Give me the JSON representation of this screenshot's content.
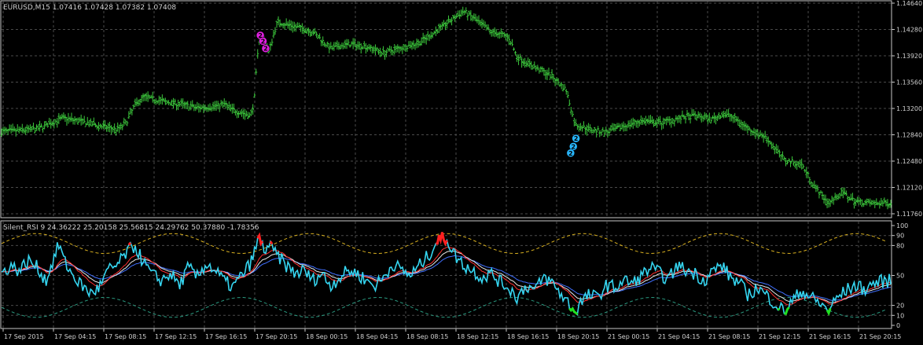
{
  "chart_data": [
    {
      "type": "candlestick",
      "title": "EURUSD,M15  1.07416 1.07428 1.07382 1.07408",
      "symbol": "EURUSD",
      "timeframe": "M15",
      "quote": {
        "open": "1.07416",
        "high": "1.07428",
        "low": "1.07382",
        "close": "1.07408"
      },
      "yticks": [
        "1.14640",
        "1.14280",
        "1.13920",
        "1.13560",
        "1.13200",
        "1.12840",
        "1.12480",
        "1.12120",
        "1.11760"
      ],
      "ylim": [
        1.1176,
        1.1464
      ],
      "grid": true,
      "price_path": [
        [
          0.0,
          1.1288
        ],
        [
          0.02,
          1.129
        ],
        [
          0.04,
          1.1292
        ],
        [
          0.06,
          1.1302
        ],
        [
          0.07,
          1.1307
        ],
        [
          0.09,
          1.1302
        ],
        [
          0.11,
          1.1296
        ],
        [
          0.13,
          1.1291
        ],
        [
          0.14,
          1.13
        ],
        [
          0.15,
          1.1325
        ],
        [
          0.16,
          1.1336
        ],
        [
          0.18,
          1.133
        ],
        [
          0.2,
          1.1326
        ],
        [
          0.22,
          1.1321
        ],
        [
          0.24,
          1.1323
        ],
        [
          0.25,
          1.1326
        ],
        [
          0.26,
          1.1318
        ],
        [
          0.28,
          1.131
        ],
        [
          0.284,
          1.1328
        ],
        [
          0.287,
          1.138
        ],
        [
          0.29,
          1.1418
        ],
        [
          0.297,
          1.141
        ],
        [
          0.3,
          1.1395
        ],
        [
          0.31,
          1.1438
        ],
        [
          0.33,
          1.1432
        ],
        [
          0.35,
          1.1425
        ],
        [
          0.37,
          1.1402
        ],
        [
          0.39,
          1.1408
        ],
        [
          0.41,
          1.1405
        ],
        [
          0.43,
          1.1396
        ],
        [
          0.45,
          1.1403
        ],
        [
          0.47,
          1.141
        ],
        [
          0.48,
          1.1418
        ],
        [
          0.5,
          1.1436
        ],
        [
          0.52,
          1.1453
        ],
        [
          0.53,
          1.1444
        ],
        [
          0.55,
          1.1425
        ],
        [
          0.57,
          1.1418
        ],
        [
          0.58,
          1.139
        ],
        [
          0.6,
          1.1376
        ],
        [
          0.61,
          1.137
        ],
        [
          0.62,
          1.1363
        ],
        [
          0.635,
          1.1345
        ],
        [
          0.645,
          1.1298
        ],
        [
          0.66,
          1.1292
        ],
        [
          0.68,
          1.1287
        ],
        [
          0.7,
          1.1296
        ],
        [
          0.72,
          1.1303
        ],
        [
          0.74,
          1.13
        ],
        [
          0.76,
          1.1306
        ],
        [
          0.78,
          1.131
        ],
        [
          0.8,
          1.1305
        ],
        [
          0.81,
          1.1312
        ],
        [
          0.82,
          1.131
        ],
        [
          0.84,
          1.1292
        ],
        [
          0.86,
          1.128
        ],
        [
          0.87,
          1.1265
        ],
        [
          0.88,
          1.125
        ],
        [
          0.9,
          1.1243
        ],
        [
          0.915,
          1.1212
        ],
        [
          0.93,
          1.119
        ],
        [
          0.945,
          1.1205
        ],
        [
          0.96,
          1.1193
        ],
        [
          0.98,
          1.119
        ],
        [
          1.0,
          1.1191
        ]
      ],
      "markers": [
        {
          "label": "2",
          "color": "#e020e0",
          "price": 1.142,
          "at": 0.291
        },
        {
          "label": "2",
          "color": "#e020e0",
          "price": 1.1412,
          "at": 0.294
        },
        {
          "label": "2",
          "color": "#e020e0",
          "price": 1.1402,
          "at": 0.297
        },
        {
          "label": "2",
          "color": "#28b8ff",
          "price": 1.1279,
          "at": 0.646
        },
        {
          "label": "2",
          "color": "#28b8ff",
          "price": 1.1268,
          "at": 0.643
        },
        {
          "label": "2",
          "color": "#28b8ff",
          "price": 1.1259,
          "at": 0.64
        }
      ],
      "colors": {
        "bars": "#3cc83c",
        "grid": "#4a4a4a",
        "text": "#d0d0d0",
        "background": "#000000"
      }
    },
    {
      "type": "line",
      "title": "Silent_RSI 9  24.36222 25.20158 25.56815 24.29762 50.37880 -1.78356",
      "indicator": "Silent_RSI",
      "period": "9",
      "values_label": [
        "24.36222",
        "25.20158",
        "25.56815",
        "24.29762",
        "50.37880",
        "-1.78356"
      ],
      "yticks": [
        "100",
        "90",
        "80",
        "50",
        "20",
        "10",
        "0"
      ],
      "ylim": [
        0,
        100
      ],
      "levels": [
        10,
        20,
        50,
        80,
        90
      ],
      "rsi_path": [
        [
          0.0,
          52
        ],
        [
          0.01,
          60
        ],
        [
          0.02,
          55
        ],
        [
          0.03,
          65
        ],
        [
          0.04,
          58
        ],
        [
          0.05,
          45
        ],
        [
          0.06,
          70
        ],
        [
          0.065,
          82
        ],
        [
          0.07,
          65
        ],
        [
          0.08,
          50
        ],
        [
          0.09,
          40
        ],
        [
          0.1,
          32
        ],
        [
          0.11,
          38
        ],
        [
          0.12,
          55
        ],
        [
          0.13,
          60
        ],
        [
          0.14,
          72
        ],
        [
          0.15,
          80
        ],
        [
          0.16,
          62
        ],
        [
          0.17,
          50
        ],
        [
          0.18,
          45
        ],
        [
          0.19,
          52
        ],
        [
          0.2,
          40
        ],
        [
          0.21,
          58
        ],
        [
          0.22,
          48
        ],
        [
          0.23,
          62
        ],
        [
          0.24,
          55
        ],
        [
          0.25,
          45
        ],
        [
          0.26,
          38
        ],
        [
          0.27,
          50
        ],
        [
          0.28,
          62
        ],
        [
          0.29,
          88
        ],
        [
          0.295,
          75
        ],
        [
          0.3,
          80
        ],
        [
          0.31,
          70
        ],
        [
          0.32,
          60
        ],
        [
          0.33,
          52
        ],
        [
          0.34,
          55
        ],
        [
          0.35,
          45
        ],
        [
          0.36,
          52
        ],
        [
          0.37,
          40
        ],
        [
          0.38,
          48
        ],
        [
          0.39,
          55
        ],
        [
          0.4,
          52
        ],
        [
          0.41,
          45
        ],
        [
          0.42,
          40
        ],
        [
          0.43,
          48
        ],
        [
          0.44,
          62
        ],
        [
          0.45,
          55
        ],
        [
          0.46,
          50
        ],
        [
          0.47,
          60
        ],
        [
          0.48,
          70
        ],
        [
          0.49,
          85
        ],
        [
          0.5,
          88
        ],
        [
          0.51,
          70
        ],
        [
          0.52,
          60
        ],
        [
          0.53,
          55
        ],
        [
          0.54,
          48
        ],
        [
          0.55,
          52
        ],
        [
          0.56,
          44
        ],
        [
          0.57,
          38
        ],
        [
          0.58,
          28
        ],
        [
          0.59,
          40
        ],
        [
          0.6,
          35
        ],
        [
          0.61,
          48
        ],
        [
          0.62,
          42
        ],
        [
          0.63,
          30
        ],
        [
          0.64,
          20
        ],
        [
          0.645,
          12
        ],
        [
          0.65,
          22
        ],
        [
          0.66,
          30
        ],
        [
          0.67,
          28
        ],
        [
          0.68,
          40
        ],
        [
          0.69,
          38
        ],
        [
          0.7,
          45
        ],
        [
          0.71,
          42
        ],
        [
          0.72,
          50
        ],
        [
          0.73,
          58
        ],
        [
          0.74,
          52
        ],
        [
          0.75,
          46
        ],
        [
          0.76,
          60
        ],
        [
          0.77,
          55
        ],
        [
          0.78,
          52
        ],
        [
          0.79,
          45
        ],
        [
          0.8,
          55
        ],
        [
          0.81,
          60
        ],
        [
          0.82,
          48
        ],
        [
          0.83,
          42
        ],
        [
          0.84,
          30
        ],
        [
          0.85,
          38
        ],
        [
          0.86,
          30
        ],
        [
          0.87,
          22
        ],
        [
          0.88,
          14
        ],
        [
          0.89,
          25
        ],
        [
          0.9,
          35
        ],
        [
          0.91,
          28
        ],
        [
          0.92,
          22
        ],
        [
          0.93,
          15
        ],
        [
          0.94,
          28
        ],
        [
          0.95,
          35
        ],
        [
          0.96,
          40
        ],
        [
          0.97,
          36
        ],
        [
          0.98,
          42
        ],
        [
          0.99,
          44
        ],
        [
          1.0,
          45
        ]
      ],
      "colors": {
        "rsi": "#35d5f0",
        "ma_fast": "#ff3030",
        "ma_slow": "#4070ff",
        "ma_mid": "#e8e8e8",
        "band_upper": "#d8b020",
        "band_lower": "#2a9a80",
        "overbought": "#ff2020",
        "oversold": "#20e020"
      }
    }
  ],
  "x_axis": {
    "tick_labels": [
      "17 Sep 2015",
      "17 Sep 04:15",
      "17 Sep 08:15",
      "17 Sep 12:15",
      "17 Sep 16:15",
      "17 Sep 20:15",
      "18 Sep 00:15",
      "18 Sep 04:15",
      "18 Sep 08:15",
      "18 Sep 12:15",
      "18 Sep 16:15",
      "18 Sep 20:15",
      "21 Sep 00:15",
      "21 Sep 04:15",
      "21 Sep 08:15",
      "21 Sep 12:15",
      "21 Sep 16:15",
      "21 Sep 20:15"
    ]
  }
}
